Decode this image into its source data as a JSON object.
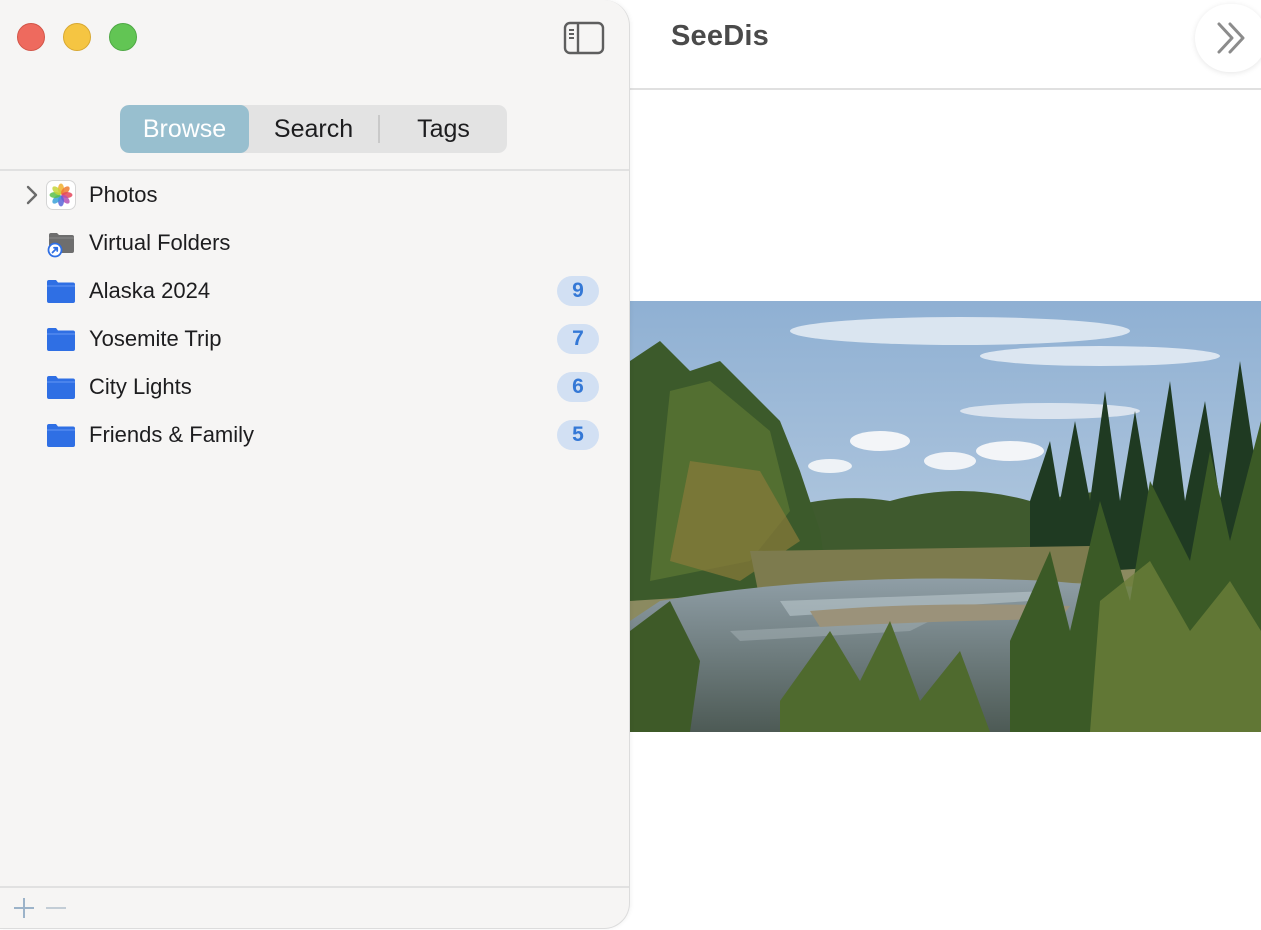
{
  "app": {
    "title": "SeeDis"
  },
  "sidebar": {
    "segments": [
      {
        "label": "Browse",
        "selected": true
      },
      {
        "label": "Search",
        "selected": false
      },
      {
        "label": "Tags",
        "selected": false
      }
    ],
    "items": [
      {
        "label": "Photos",
        "icon": "photos-app-icon",
        "expandable": true
      },
      {
        "label": "Virtual Folders",
        "icon": "alias-folder-icon"
      },
      {
        "label": "Alaska 2024",
        "icon": "folder-icon",
        "count": "9"
      },
      {
        "label": "Yosemite Trip",
        "icon": "folder-icon",
        "count": "7"
      },
      {
        "label": "City Lights",
        "icon": "folder-icon",
        "count": "6"
      },
      {
        "label": "Friends & Family",
        "icon": "folder-icon",
        "count": "5"
      }
    ],
    "footer": {
      "add_icon": "plus-icon",
      "remove_icon": "minus-icon"
    }
  },
  "colors": {
    "segment_selected": "#98bfcf",
    "badge_bg": "#d2e0f3",
    "badge_text": "#3478d6",
    "folder_blue": "#2f6fe4"
  }
}
